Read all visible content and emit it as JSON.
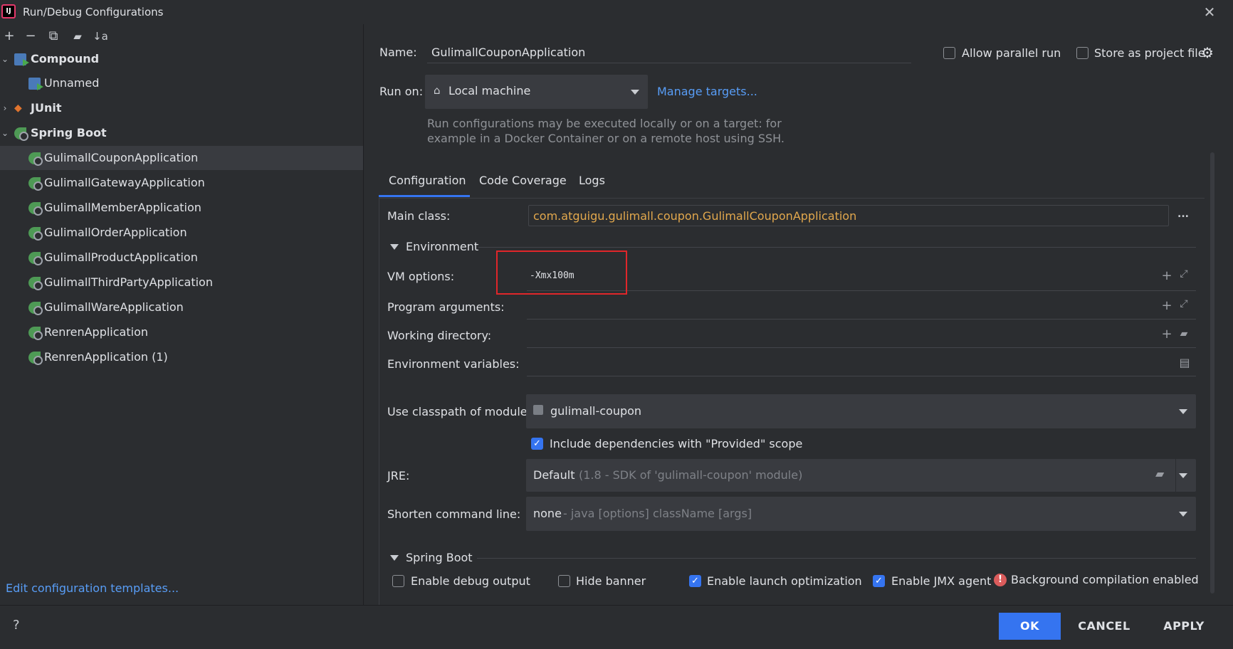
{
  "window": {
    "title": "Run/Debug Configurations",
    "app_icon_text": "IJ"
  },
  "toolbar": {
    "icons": [
      "add-icon",
      "remove-icon",
      "copy-icon",
      "new-folder-icon",
      "sort-icon"
    ],
    "glyphs": [
      "+",
      "−",
      "⧉",
      "📁",
      "↓a"
    ]
  },
  "tree": {
    "compound": {
      "label": "Compound",
      "children": [
        "Unnamed"
      ]
    },
    "junit": {
      "label": "JUnit"
    },
    "spring_boot": {
      "label": "Spring Boot",
      "children": [
        "GulimallCouponApplication",
        "GulimallGatewayApplication",
        "GulimallMemberApplication",
        "GulimallOrderApplication",
        "GulimallProductApplication",
        "GulimallThirdPartyApplication",
        "GulimallWareApplication",
        "RenrenApplication",
        "RenrenApplication (1)"
      ]
    }
  },
  "edit_templates_link": "Edit configuration templates...",
  "name_label": "Name:",
  "name_value": "GulimallCouponApplication",
  "allow_parallel_label": "Allow parallel run",
  "store_project_label": "Store as project file",
  "run_on_label": "Run on:",
  "run_on_value": "Local machine",
  "manage_targets": "Manage targets...",
  "run_on_hint_1": "Run configurations may be executed locally or on a target: for",
  "run_on_hint_2": "example in a Docker Container or on a remote host using SSH.",
  "tabs": [
    "Configuration",
    "Code Coverage",
    "Logs"
  ],
  "main_class_label": "Main class:",
  "main_class_value": "com.atguigu.gulimall.coupon.GulimallCouponApplication",
  "ellipsis": "...",
  "environment_section": "Environment",
  "vm_options_label": "VM options:",
  "vm_options_value": "-Xmx100m",
  "program_args_label": "Program arguments:",
  "working_dir_label": "Working directory:",
  "env_vars_label": "Environment variables:",
  "classpath_label": "Use classpath of module:",
  "classpath_value": "gulimall-coupon",
  "include_deps_label": "Include dependencies with \"Provided\" scope",
  "jre_label": "JRE:",
  "jre_value": "Default",
  "jre_hint": "(1.8 - SDK of 'gulimall-coupon' module)",
  "shorten_label": "Shorten command line:",
  "shorten_value": "none",
  "shorten_hint": "- java [options] className [args]",
  "spring_boot_section": "Spring Boot",
  "enable_debug_label": "Enable debug output",
  "hide_banner_label": "Hide banner",
  "launch_opt_label": "Enable launch optimization",
  "jmx_label": "Enable JMX agent",
  "bg_compile_label": "Background compilation enabled",
  "buttons": {
    "help": "?",
    "ok": "OK",
    "cancel": "CANCEL",
    "apply": "APPLY"
  },
  "checkbox_states": {
    "allow_parallel": false,
    "store_project": false,
    "include_deps": true,
    "enable_debug": false,
    "hide_banner": false,
    "launch_opt": true,
    "jmx": true
  },
  "colors": {
    "accent": "#3574f0",
    "link": "#589df6",
    "main_class_text": "#e2a84d",
    "highlight_box": "#e0262a"
  }
}
